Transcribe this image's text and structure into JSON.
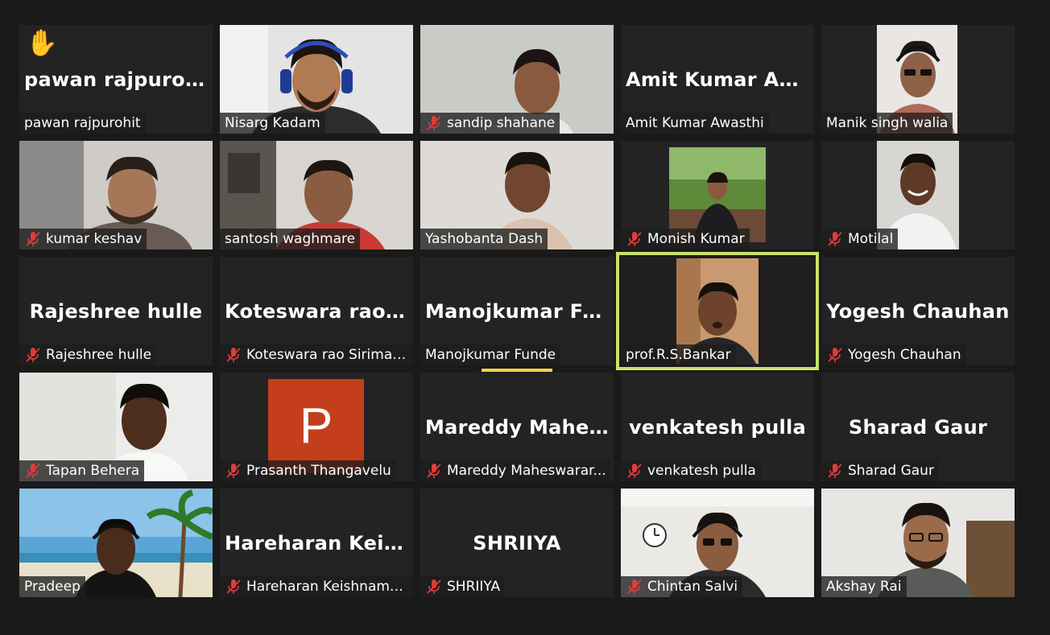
{
  "meeting": {
    "accent_active": "#c8e36a",
    "muted_icon_color": "#e03c3c",
    "participants": [
      {
        "name": "pawan rajpurohit",
        "display": "pawan rajpurohit",
        "video": false,
        "muted": false,
        "hand_raised": true,
        "hand_icon": "raised-hand-icon"
      },
      {
        "name": "Nisarg Kadam",
        "video": true,
        "muted": false
      },
      {
        "name": "sandip shahane",
        "video": true,
        "muted": true
      },
      {
        "name": "Amit Kumar Awasthi",
        "display": "Amit Kumar Aw...",
        "video": false,
        "muted": false
      },
      {
        "name": "Manik singh walia",
        "video": true,
        "muted": false
      },
      {
        "name": "kumar keshav",
        "video": true,
        "muted": true
      },
      {
        "name": "santosh waghmare",
        "video": true,
        "muted": false
      },
      {
        "name": "Yashobanta Dash",
        "video": true,
        "muted": false
      },
      {
        "name": "Monish Kumar",
        "video": true,
        "muted": true
      },
      {
        "name": "Motilal",
        "video": true,
        "muted": true
      },
      {
        "name": "Rajeshree hulle",
        "display": "Rajeshree hulle",
        "video": false,
        "muted": true
      },
      {
        "name": "Koteswara rao Sirimalle",
        "display": "Koteswara rao...",
        "video": false,
        "muted": true
      },
      {
        "name": "Manojkumar Funde",
        "display": "Manojkumar Fu...",
        "video": false,
        "muted": false
      },
      {
        "name": "prof.R.S.Bankar",
        "video": true,
        "muted": false,
        "active_speaker": true
      },
      {
        "name": "Yogesh Chauhan",
        "display": "Yogesh Chauhan",
        "video": false,
        "muted": true
      },
      {
        "name": "Tapan Behera",
        "video": true,
        "muted": true
      },
      {
        "name": "Prasanth Thangavelu",
        "video": false,
        "muted": true,
        "avatar_letter": "P",
        "avatar_color": "#c43e1c"
      },
      {
        "name": "Mareddy Maheswarar...",
        "display": "Mareddy Mahe...",
        "video": false,
        "muted": true
      },
      {
        "name": "venkatesh pulla",
        "display": "venkatesh pulla",
        "video": false,
        "muted": true
      },
      {
        "name": "Sharad Gaur",
        "display": "Sharad Gaur",
        "video": false,
        "muted": true
      },
      {
        "name": "Pradeep",
        "video": true,
        "muted": false
      },
      {
        "name": "Hareharan Keishnamo...",
        "display": "Hareharan Keis...",
        "video": false,
        "muted": true
      },
      {
        "name": "SHRIIYA",
        "display": "SHRIIYA",
        "video": false,
        "muted": true
      },
      {
        "name": "Chintan Salvi",
        "video": true,
        "muted": true
      },
      {
        "name": "Akshay Rai",
        "video": true,
        "muted": false
      }
    ]
  }
}
